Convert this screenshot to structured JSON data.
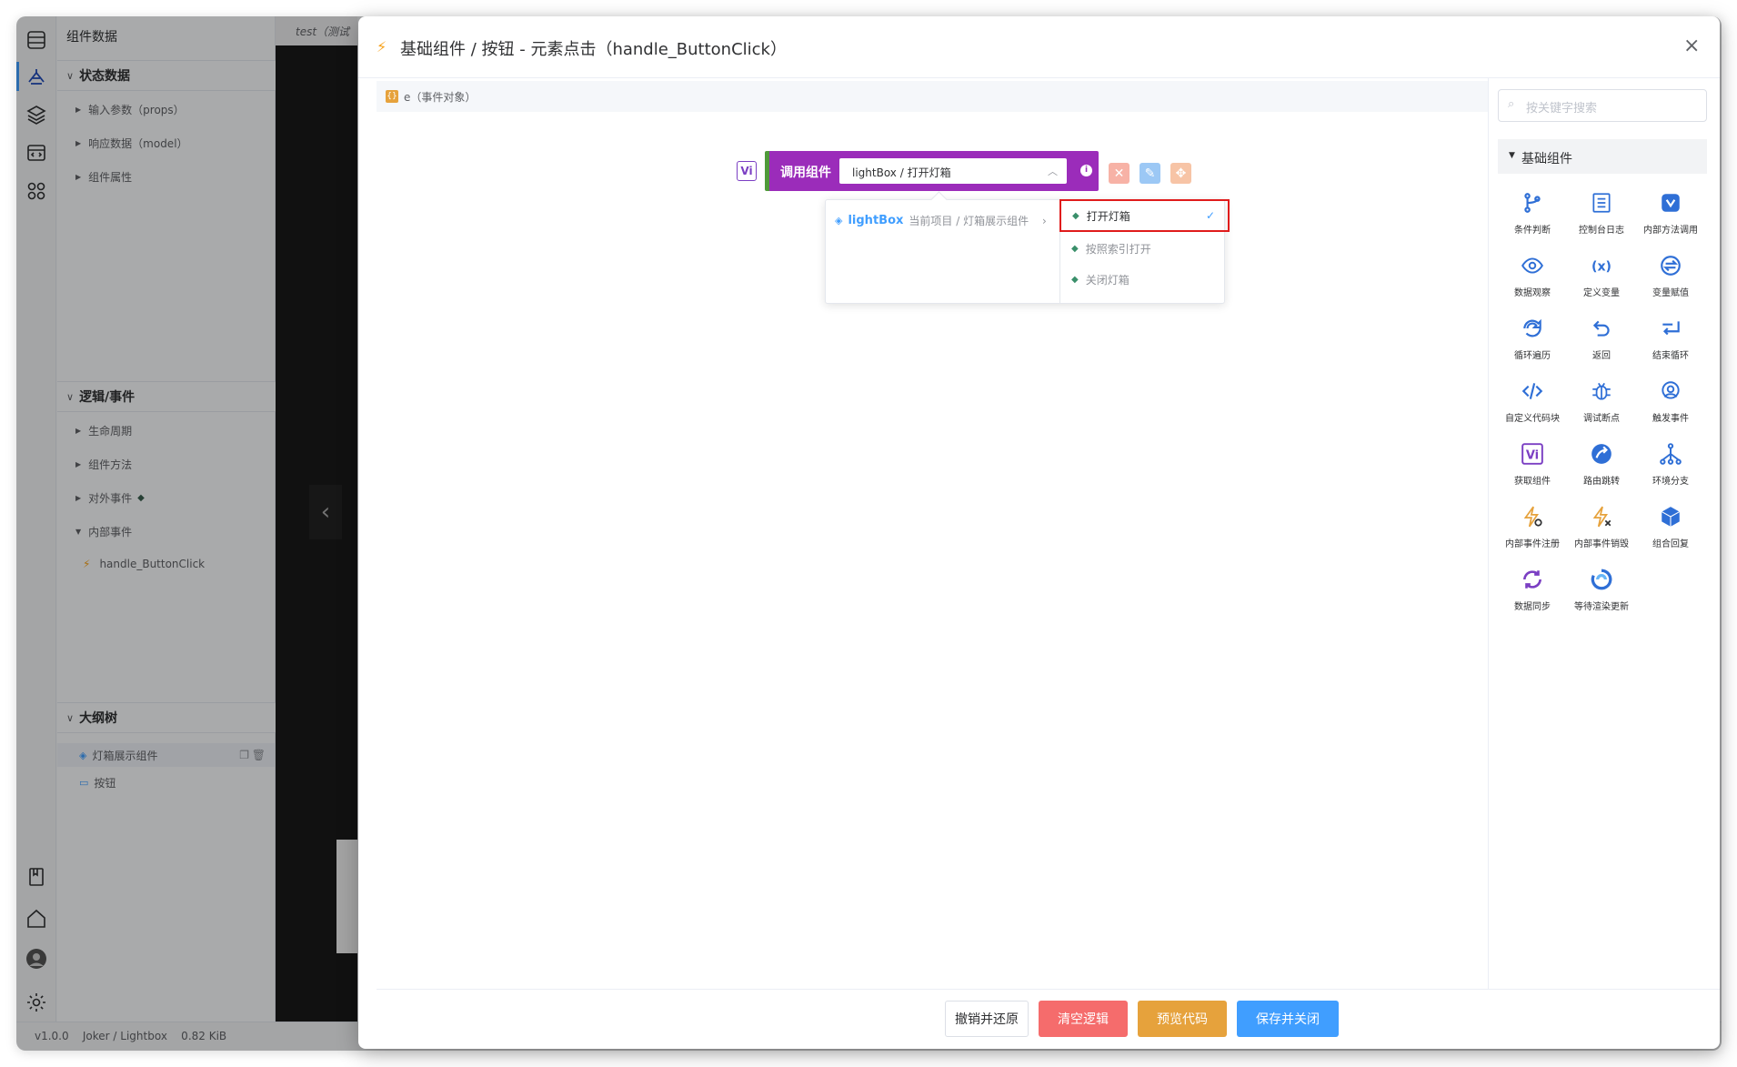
{
  "left_panel": {
    "title": "组件数据",
    "sections": [
      {
        "title": "状态数据",
        "items": [
          "输入参数（props）",
          "响应数据（model）",
          "组件属性"
        ]
      },
      {
        "title": "逻辑/事件",
        "items": [
          "生命周期",
          "组件方法",
          "对外事件",
          "内部事件"
        ],
        "event_child": "handle_ButtonClick"
      },
      {
        "title": "大纲树",
        "items": [
          "灯箱展示组件",
          "按钮"
        ]
      }
    ]
  },
  "canvas_tab": "test（测试",
  "status_bar": "v1.0.0    Joker / Lightbox    0.82 KiB",
  "modal": {
    "title": "基础组件 / 按钮 - 元素点击（handle_ButtonClick）",
    "close_label": "×",
    "context_var": "e（事件对象）",
    "block": {
      "badge": "Vi",
      "label": "调用组件",
      "value": "lightBox / 打开灯箱",
      "info": "i"
    },
    "cascader": {
      "left_name": "lightBox",
      "left_path": "当前项目 / 灯箱展示组件",
      "options": [
        "打开灯箱",
        "按照索引打开",
        "关闭灯箱"
      ],
      "selected": "打开灯箱"
    },
    "search_placeholder": "按关键字搜索",
    "tool_section": "基础组件",
    "tools": [
      {
        "label": "条件判断",
        "icon": "branch-icon"
      },
      {
        "label": "控制台日志",
        "icon": "log-icon"
      },
      {
        "label": "内部方法调用",
        "icon": "method-call-icon"
      },
      {
        "label": "数据观察",
        "icon": "eye-icon"
      },
      {
        "label": "定义变量",
        "icon": "variable-icon"
      },
      {
        "label": "变量赋值",
        "icon": "assign-icon"
      },
      {
        "label": "循环遍历",
        "icon": "loop-icon"
      },
      {
        "label": "返回",
        "icon": "return-icon"
      },
      {
        "label": "结束循环",
        "icon": "break-icon"
      },
      {
        "label": "自定义代码块",
        "icon": "code-icon"
      },
      {
        "label": "调试断点",
        "icon": "bug-icon"
      },
      {
        "label": "触发事件",
        "icon": "trigger-icon"
      },
      {
        "label": "获取组件",
        "icon": "vi-icon"
      },
      {
        "label": "路由跳转",
        "icon": "route-icon"
      },
      {
        "label": "环境分支",
        "icon": "env-branch-icon"
      },
      {
        "label": "内部事件注册",
        "icon": "event-register-icon"
      },
      {
        "label": "内部事件销毁",
        "icon": "event-destroy-icon"
      },
      {
        "label": "组合回复",
        "icon": "combine-icon"
      },
      {
        "label": "数据同步",
        "icon": "sync-icon"
      },
      {
        "label": "等待渲染更新",
        "icon": "wait-render-icon"
      }
    ],
    "buttons": {
      "cancel": "撤销并还原",
      "clear": "清空逻辑",
      "preview": "预览代码",
      "save": "保存并关闭"
    }
  },
  "colors": {
    "accent": "#409eff",
    "block": "#9b2cba",
    "danger": "#f56c6c",
    "warning": "#e6a23c",
    "highlight": "#e01b1b"
  }
}
